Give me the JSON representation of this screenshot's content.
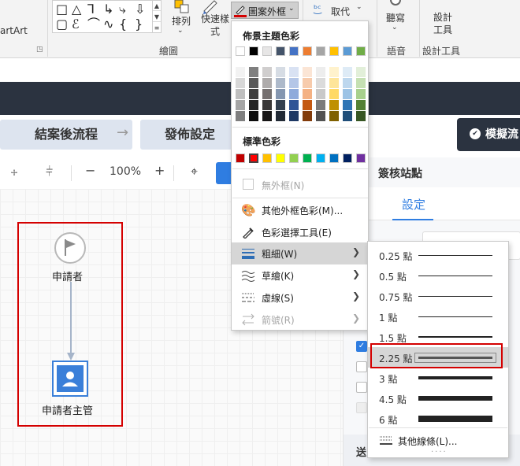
{
  "ribbon": {
    "smartart_label": "artArt",
    "arrange_label": "排列",
    "quick_style_label": "快速樣式",
    "outline_button_label": "圖案外框",
    "replace_label": "取代",
    "dictate_label": "聽寫",
    "design_tools_label": "設計工具",
    "group_drawing": "繪圖",
    "group_voice": "語音",
    "group_design": "設計工具",
    "outline_color": "#d40000"
  },
  "workflow": {
    "steps": [
      {
        "label": "結案後流程"
      },
      {
        "label": "發佈設定"
      }
    ],
    "simulate_label": "模擬流",
    "zoom_value": "100%",
    "zoom_minus": "−",
    "zoom_plus": "+",
    "nodes": {
      "applicant": "申請者",
      "supervisor": "申請者主管"
    }
  },
  "right_panel": {
    "title": "簽核站點",
    "tab_settings": "設定",
    "footer_label": "送"
  },
  "menu": {
    "theme_colors_heading": "佈景主題色彩",
    "theme_top_row": [
      "#ffffff",
      "#000000",
      "#e7e6e6",
      "#44546a",
      "#4472c4",
      "#ed7d31",
      "#a5a5a5",
      "#ffc000",
      "#5b9bd5",
      "#70ad47"
    ],
    "theme_shades": [
      [
        "#f2f2f2",
        "#7f7f7f",
        "#d0cece",
        "#d6dce4",
        "#d9e2f3",
        "#fbe5d5",
        "#ededed",
        "#fff2cc",
        "#deebf6",
        "#e2efd9"
      ],
      [
        "#d8d8d8",
        "#595959",
        "#aeabab",
        "#adb9ca",
        "#b4c6e7",
        "#f7cbac",
        "#dbdbdb",
        "#fee599",
        "#bdd7ee",
        "#c5e0b3"
      ],
      [
        "#bfbfbf",
        "#3f3f3f",
        "#757070",
        "#8496b0",
        "#8eaadb",
        "#f4b183",
        "#c9c9c9",
        "#ffd965",
        "#9cc3e5",
        "#a8d08d"
      ],
      [
        "#a5a5a5",
        "#262626",
        "#3a3838",
        "#323f4f",
        "#2f5496",
        "#c45911",
        "#7b7b7b",
        "#bf9000",
        "#2e75b5",
        "#538135"
      ],
      [
        "#7f7f7f",
        "#0c0c0c",
        "#171616",
        "#222a35",
        "#1e3864",
        "#833c0b",
        "#525252",
        "#7f6000",
        "#1f4e79",
        "#375623"
      ]
    ],
    "standard_colors_heading": "標準色彩",
    "standard_colors": [
      "#c00000",
      "#ff0000",
      "#ffc000",
      "#ffff00",
      "#92d050",
      "#00b050",
      "#00b0f0",
      "#0070c0",
      "#002060",
      "#7030a0"
    ],
    "no_outline": "無外框(N)",
    "more_colors": "其他外框色彩(M)...",
    "eyedropper": "色彩選擇工具(E)",
    "weight": "粗細(W)",
    "sketched": "草繪(K)",
    "dashes": "虛線(S)",
    "arrows": "箭號(R)"
  },
  "weight_submenu": {
    "items": [
      {
        "label": "0.25 點",
        "points": 0.25
      },
      {
        "label": "0.5 點",
        "points": 0.5
      },
      {
        "label": "0.75 點",
        "points": 0.75
      },
      {
        "label": "1 點",
        "points": 1
      },
      {
        "label": "1.5 點",
        "points": 1.5
      },
      {
        "label": "2.25 點",
        "points": 2.25
      },
      {
        "label": "3 點",
        "points": 3
      },
      {
        "label": "4.5 點",
        "points": 4.5
      },
      {
        "label": "6 點",
        "points": 6
      }
    ],
    "selected": "2.25 點",
    "more_lines": "其他線條(L)..."
  }
}
